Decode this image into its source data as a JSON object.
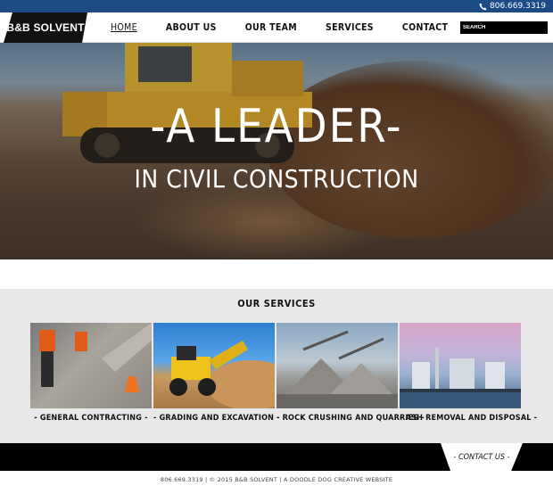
{
  "topbar": {
    "phone": "806.669.3319",
    "phone_icon": "phone-icon"
  },
  "nav": {
    "logo": "B&B SOLVENT",
    "items": [
      {
        "label": "HOME",
        "active": true
      },
      {
        "label": "ABOUT US",
        "active": false
      },
      {
        "label": "OUR TEAM",
        "active": false
      },
      {
        "label": "SERVICES",
        "active": false
      },
      {
        "label": "CONTACT",
        "active": false
      }
    ],
    "search_placeholder": "SEARCH"
  },
  "hero": {
    "line1": "-A LEADER-",
    "line2": "IN CIVIL CONSTRUCTION"
  },
  "services": {
    "title": "OUR SERVICES",
    "cards": [
      {
        "label": "- GENERAL CONTRACTING -"
      },
      {
        "label": "- GRADING AND EXCAVATION -"
      },
      {
        "label": "- ROCK CRUSHING AND QUARRIES -"
      },
      {
        "label": "- ASH REMOVAL AND DISPOSAL -"
      }
    ]
  },
  "footer": {
    "contact_label": "- CONTACT US -",
    "copyright": "806.669.3319 | © 2015 B&B SOLVENT | A DOODLE DOG CREATIVE WEBSITE"
  },
  "colors": {
    "topbar": "#1d4b86",
    "dark": "#000000",
    "services_bg": "#e8e8e8"
  }
}
